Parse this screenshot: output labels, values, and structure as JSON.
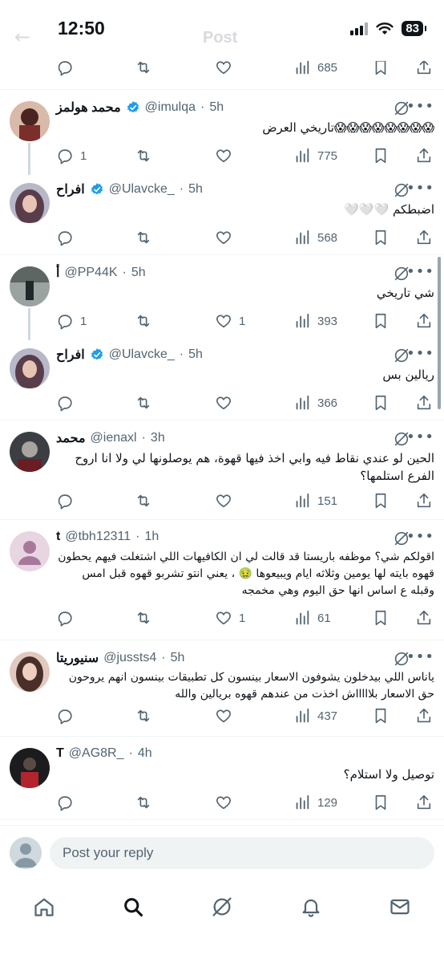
{
  "status_bar": {
    "time": "12:50",
    "battery": "83"
  },
  "header_ghost": {
    "title": "Post"
  },
  "top_actions": {
    "views": "685"
  },
  "tweets": [
    {
      "name": "محمد هولمز",
      "handle": "@imulqa",
      "ago": "5h",
      "verified": true,
      "text": "😱😱😱😱😱😱😱😱تاريخي العرض",
      "reply_count": "1",
      "retweet_count": "",
      "like_count": "",
      "views": "775"
    },
    {
      "name": "افراح",
      "handle": "@Ulavcke_",
      "ago": "5h",
      "verified": true,
      "text": "اضبطكم 🤍🤍🤍",
      "reply_count": "",
      "retweet_count": "",
      "like_count": "",
      "views": "568"
    },
    {
      "name": "أ",
      "handle": "@PP44K",
      "ago": "5h",
      "verified": false,
      "text": "شي تاريخي",
      "reply_count": "1",
      "retweet_count": "",
      "like_count": "1",
      "views": "393"
    },
    {
      "name": "افراح",
      "handle": "@Ulavcke_",
      "ago": "5h",
      "verified": true,
      "text": "ريالين بس",
      "reply_count": "",
      "retweet_count": "",
      "like_count": "",
      "views": "366"
    },
    {
      "name": "محمد",
      "handle": "@ienaxl",
      "ago": "3h",
      "verified": false,
      "text": "الحين لو عندي نقاط فيه وابي اخذ فيها قهوة، هم يوصلونها لي ولا انا اروح الفرع استلمها؟",
      "reply_count": "",
      "retweet_count": "",
      "like_count": "",
      "views": "151"
    },
    {
      "name": "t",
      "handle": "@tbh12311",
      "ago": "1h",
      "verified": false,
      "text": "اقولكم شي؟ موظفه باريستا قد قالت لي ان الكافيهات اللي اشتغلت فيهم يحطون قهوه بايته لها يومين وثلاثه ايام ويبيعوها 🤢 ، يعني انتو تشربو قهوه قبل امس وقبله ع اساس انها حق اليوم وهي مخمجه",
      "reply_count": "",
      "retweet_count": "",
      "like_count": "1",
      "views": "61"
    },
    {
      "name": "سنيوريتا",
      "handle": "@jussts4",
      "ago": "5h",
      "verified": false,
      "text": "ياناس اللي بيدخلون يشوفون الاسعار بينسون كل تطبيقات بينسون انهم يروحون حق الاسعار بلاااااش اخذت من عندهم قهوه بريالين والله",
      "reply_count": "",
      "retweet_count": "",
      "like_count": "",
      "views": "437"
    },
    {
      "name": "T",
      "handle": "@AG8R_",
      "ago": "4h",
      "verified": false,
      "text": "توصيل ولا استلام؟",
      "reply_count": "",
      "retweet_count": "",
      "like_count": "",
      "views": "129"
    }
  ],
  "reply_bar": {
    "placeholder": "Post your reply"
  },
  "tabbar": {
    "items": [
      "home-icon",
      "search-icon",
      "grok-icon",
      "notifications-icon",
      "messages-icon"
    ]
  },
  "colors": {
    "accent": "#1d9bf0",
    "text": "#0f1419",
    "secondary": "#536471",
    "divider": "#eff3f4"
  }
}
